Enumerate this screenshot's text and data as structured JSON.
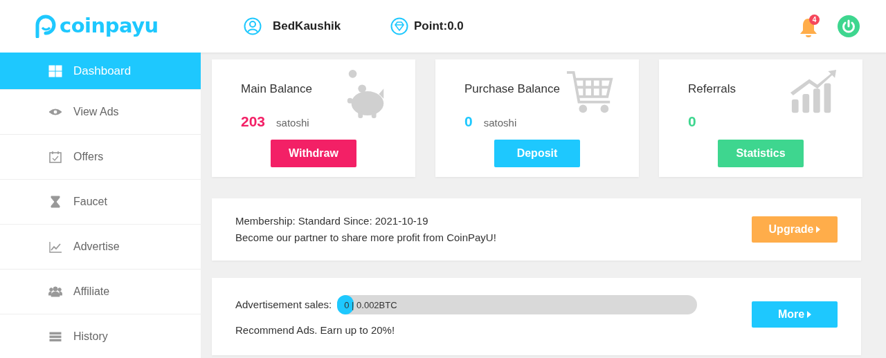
{
  "header": {
    "logo": "coinpayu",
    "username": "BedKaushik",
    "points": "Point:0.0",
    "notifications": "4"
  },
  "sidebar": {
    "items": [
      {
        "label": "Dashboard",
        "selected": true
      },
      {
        "label": "View Ads",
        "selected": false
      },
      {
        "label": "Offers",
        "selected": false
      },
      {
        "label": "Faucet",
        "selected": false
      },
      {
        "label": "Advertise",
        "selected": false
      },
      {
        "label": "Affiliate",
        "selected": false
      },
      {
        "label": "History",
        "selected": false
      }
    ]
  },
  "stats": [
    {
      "title": "Main Balance",
      "value": "203",
      "unit": "satoshi",
      "button": "Withdraw",
      "color": "#f32066"
    },
    {
      "title": "Purchase Balance",
      "value": "0",
      "unit": "satoshi",
      "button": "Deposit",
      "color": "#1ec8fe"
    },
    {
      "title": "Referrals",
      "value": "0",
      "button": "Statistics",
      "color": "#3ed68f"
    }
  ],
  "membership": {
    "line_1": "Membership: Standard Since: 2021-10-19",
    "line_2": "Become our partner to share more profit from CoinPayU!",
    "button": "Upgrade"
  },
  "ad_sales": {
    "label": "Advertisement sales:",
    "progress_text": "0 | 0.002BTC",
    "level": 0.045,
    "note": "Recommend Ads. Earn up to 20%!",
    "button": "More"
  }
}
